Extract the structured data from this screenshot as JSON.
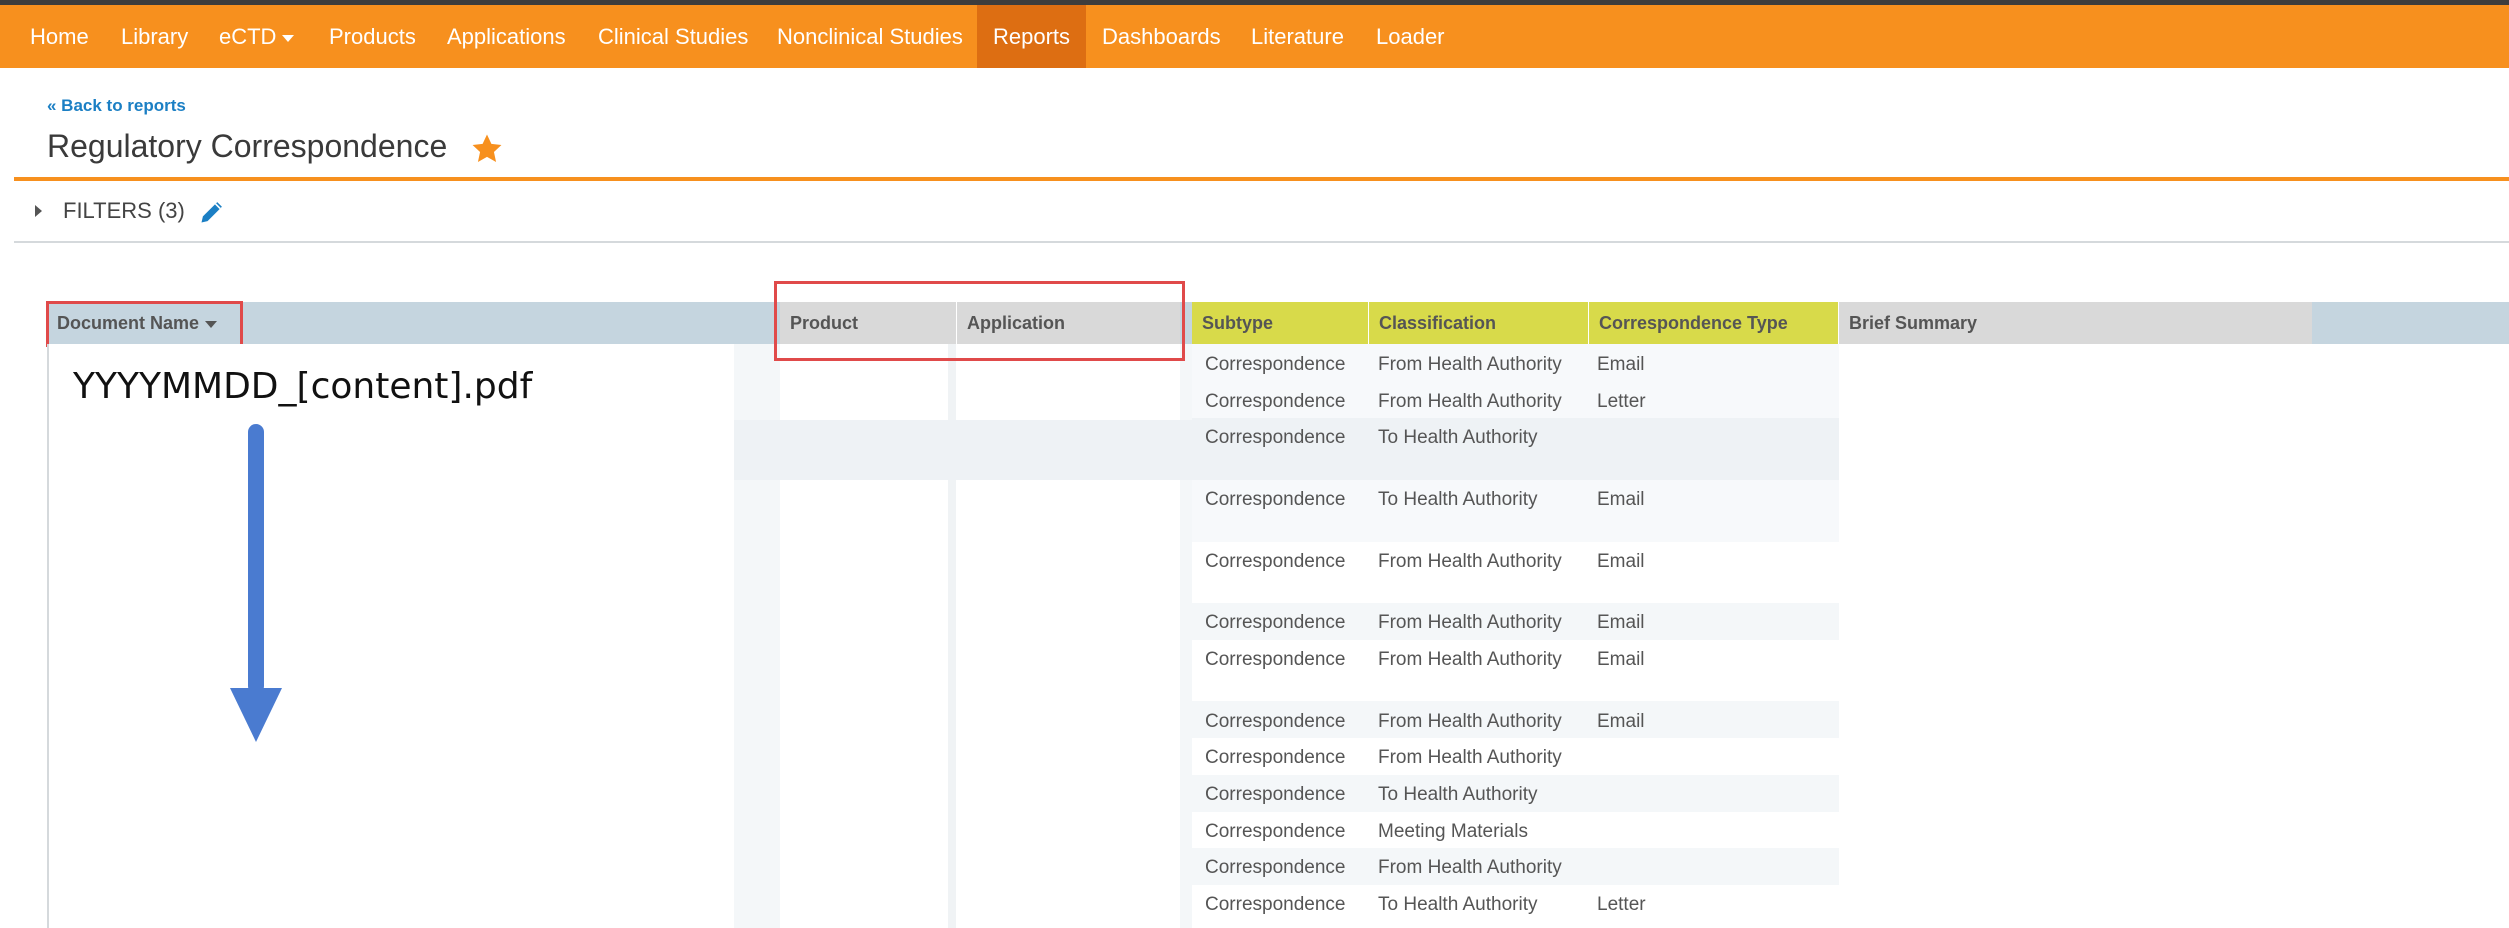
{
  "nav": {
    "items": [
      "Home",
      "Library",
      "eCTD",
      "Products",
      "Applications",
      "Clinical Studies",
      "Nonclinical Studies",
      "Reports",
      "Dashboards",
      "Literature",
      "Loader"
    ],
    "active": "Reports"
  },
  "page": {
    "back_link": "« Back to reports",
    "title": "Regulatory Correspondence",
    "filters_label": "FILTERS (3)"
  },
  "table": {
    "headers": {
      "document_name": "Document Name",
      "product": "Product",
      "application": "Application",
      "subtype": "Subtype",
      "classification": "Classification",
      "correspondence_type": "Correspondence Type",
      "brief_summary": "Brief Summary"
    },
    "rows": [
      {
        "subtype": "Correspondence",
        "classification": "From Health Authority",
        "type": "Email"
      },
      {
        "subtype": "Correspondence",
        "classification": "From Health Authority",
        "type": "Letter"
      },
      {
        "subtype": "Correspondence",
        "classification": "To Health Authority",
        "type": ""
      },
      {
        "subtype": "Correspondence",
        "classification": "To Health Authority",
        "type": "Email"
      },
      {
        "subtype": "Correspondence",
        "classification": "From Health Authority",
        "type": "Email"
      },
      {
        "subtype": "Correspondence",
        "classification": "From Health Authority",
        "type": "Email"
      },
      {
        "subtype": "Correspondence",
        "classification": "From Health Authority",
        "type": "Email"
      },
      {
        "subtype": "Correspondence",
        "classification": "From Health Authority",
        "type": "Email"
      },
      {
        "subtype": "Correspondence",
        "classification": "From Health Authority",
        "type": ""
      },
      {
        "subtype": "Correspondence",
        "classification": "To Health Authority",
        "type": ""
      },
      {
        "subtype": "Correspondence",
        "classification": "Meeting Materials",
        "type": ""
      },
      {
        "subtype": "Correspondence",
        "classification": "From Health Authority",
        "type": ""
      },
      {
        "subtype": "Correspondence",
        "classification": "To Health Authority",
        "type": "Letter"
      }
    ]
  },
  "annotation": {
    "filename_pattern": "YYYYMMDD_[content].pdf"
  },
  "colors": {
    "nav_bg": "#f7901e",
    "nav_active": "#dd6e12",
    "accent_rule": "#f7901e",
    "highlight_box": "#e04a4a",
    "header_blue": "#c5d5df",
    "header_grey": "#d9d9d9",
    "header_yellow": "#d8da4a",
    "arrow": "#4a7bd0",
    "star": "#f7901e",
    "pencil": "#1b7fc4"
  },
  "icons": [
    "star-icon",
    "pencil-icon",
    "caret-right-icon",
    "caret-down-icon",
    "down-arrow-icon"
  ]
}
